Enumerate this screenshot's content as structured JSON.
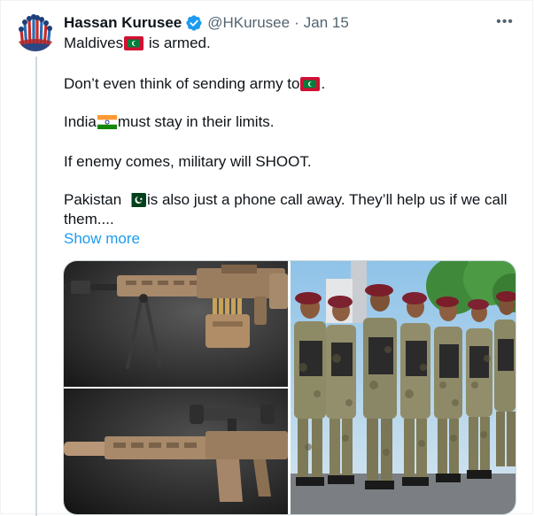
{
  "tweet": {
    "display_name": "Hassan Kurusee",
    "handle": "@HKurusee",
    "separator": "·",
    "date": "Jan 15",
    "more_glyph": "•••",
    "lines": {
      "l1_before": "Maldives",
      "l1_after": " is armed.",
      "l2_before": "Don’t even think of sending army to",
      "l2_after": ".",
      "l3_before": "India",
      "l3_after": "must stay in their limits.",
      "l4": "If enemy comes, military will SHOOT.",
      "l5_before": "Pakistan ",
      "l5_after": "is also just a phone call away. They’ll help us if we call",
      "l6": "them...."
    },
    "show_more": "Show more"
  },
  "icons": {
    "avatar": "raised-hands-avatar",
    "verified": "verified-badge-icon",
    "more": "more-options-icon",
    "flag_maldives": "maldives-flag-icon",
    "flag_india": "india-flag-icon",
    "flag_pakistan": "pakistan-flag-icon"
  },
  "colors": {
    "text": "#0f1419",
    "secondary": "#536471",
    "link": "#1d9bf0",
    "verified": "#1d9bf0",
    "border": "#cfd9de"
  }
}
